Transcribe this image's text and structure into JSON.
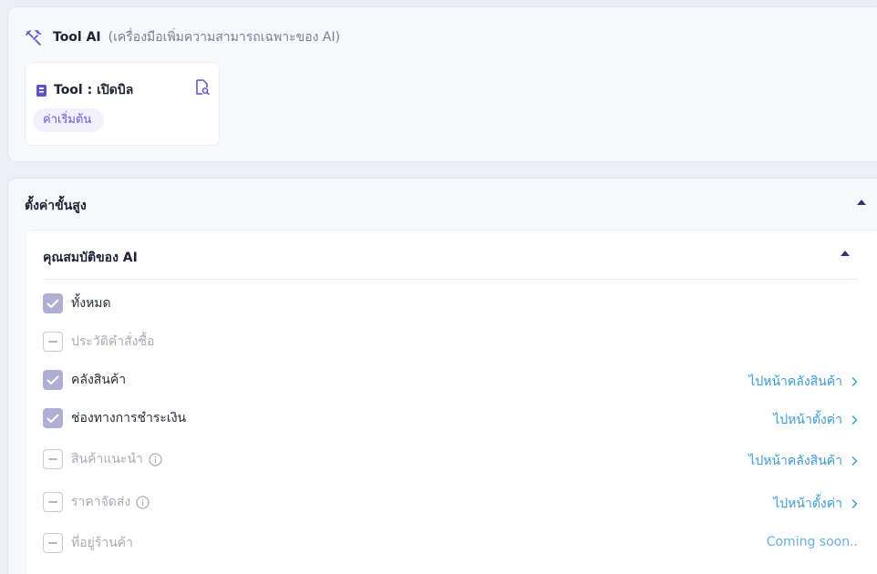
{
  "tool_section": {
    "icon": "tools-icon",
    "title": "Tool AI",
    "subtitle": "(เครื่องมือเพิ่มความสามารถเฉพาะของ AI)",
    "tool_card": {
      "icon": "book-icon",
      "title": "Tool : เปิดบิล",
      "action_icon": "document-search-icon",
      "badge": "ค่าเริ่มต้น"
    }
  },
  "advanced": {
    "title": "ตั้งค่าขั้นสูง",
    "expanded": true,
    "properties": {
      "title": "คุณสมบัติของ AI",
      "expanded": true,
      "items": [
        {
          "label": "ทั้งหมด",
          "state": "checked",
          "link": ""
        },
        {
          "label": "ประวัติคำสั่งซื้อ",
          "state": "disabled",
          "link": ""
        },
        {
          "label": "คลังสินค้า",
          "state": "checked",
          "link": "ไปหน้าคลังสินค้า"
        },
        {
          "label": "ช่องทางการชำระเงิน",
          "state": "checked",
          "link": "ไปหน้าตั้งค่า"
        },
        {
          "label": "สินค้าแนะนำ",
          "state": "disabled",
          "info": true,
          "link": "ไปหน้าคลังสินค้า"
        },
        {
          "label": "ราคาจัดส่ง",
          "state": "disabled",
          "info": true,
          "link": "ไปหน้าตั้งค่า"
        },
        {
          "label": "ที่อยู่ร้านค้า",
          "state": "disabled",
          "link": "Coming soon.."
        }
      ]
    }
  },
  "colors": {
    "accent": "#6a55e0",
    "checkbox_checked": "#b0aed4",
    "link": "#3b9bd6",
    "caret": "#3a2f7c"
  }
}
